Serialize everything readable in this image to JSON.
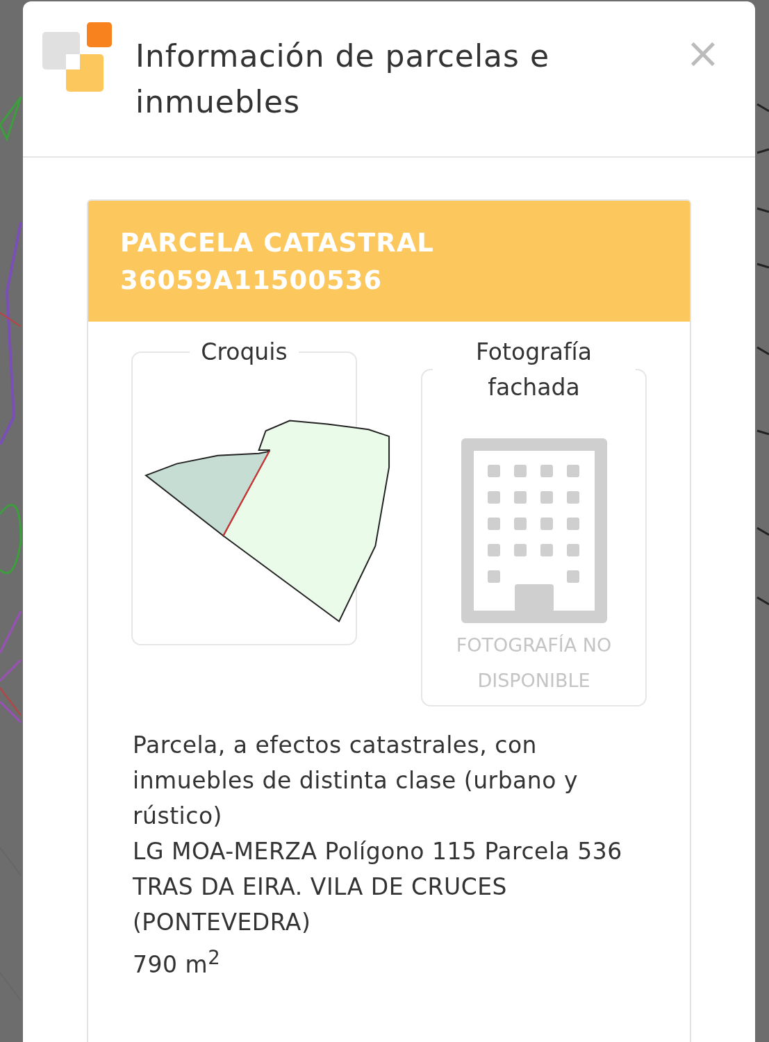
{
  "dialog": {
    "title": "Información de parcelas e inmuebles",
    "close": "×"
  },
  "card": {
    "title": "PARCELA CATASTRAL",
    "reference": "36059A11500536"
  },
  "sketch": {
    "legend": "Croquis"
  },
  "photo": {
    "legend": "Fotografía fachada",
    "message": "FOTOGRAFÍA NO DISPONIBLE"
  },
  "details": [
    "Parcela, a efectos catastrales, con inmuebles de distinta clase (urbano y rústico)",
    "LG MOA-MERZA Polígono 115 Parcela 536",
    "TRAS DA EIRA. VILA DE CRUCES (PONTEVEDRA)",
    "790 m$^{2}$"
  ]
}
